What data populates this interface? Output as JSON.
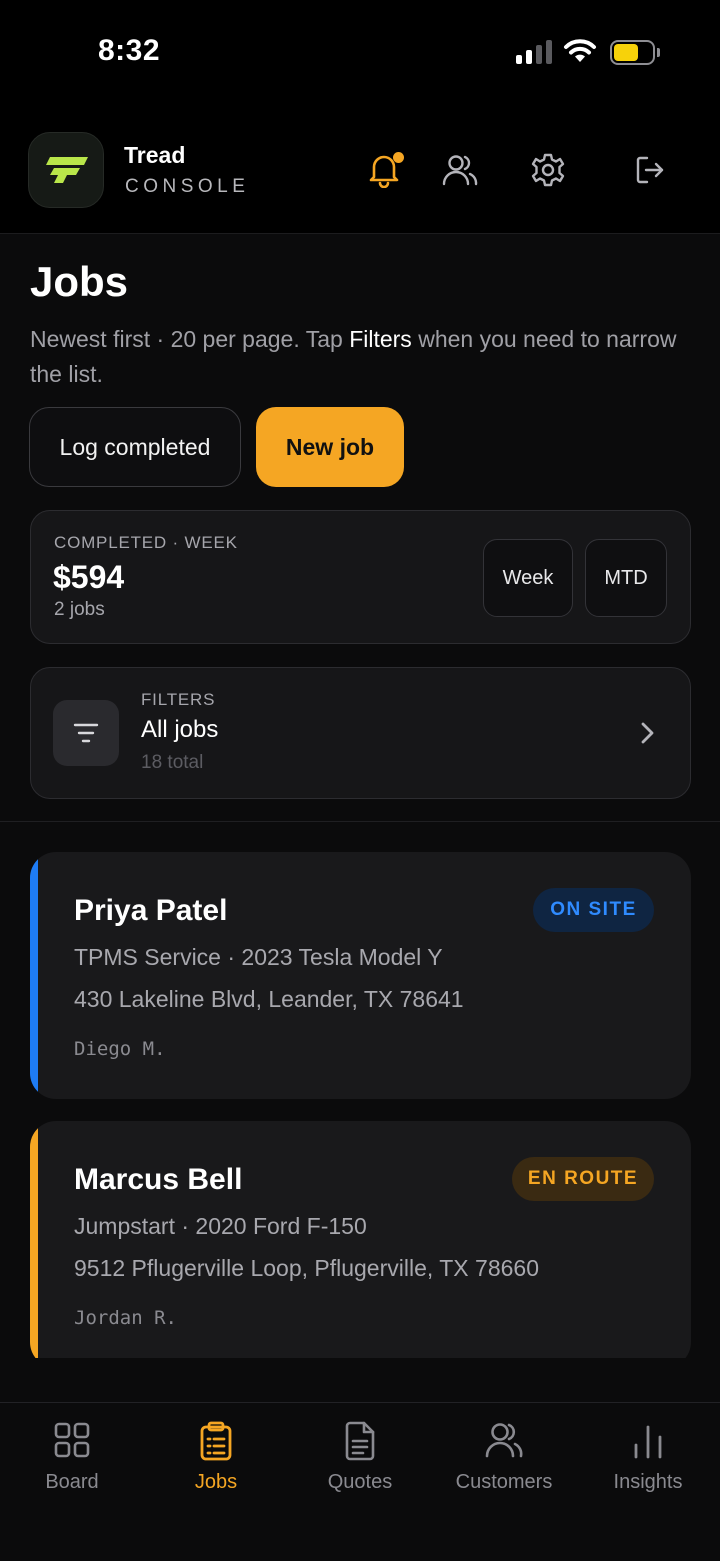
{
  "status_bar": {
    "time": "8:32"
  },
  "header": {
    "brand_name": "Tread",
    "brand_sub": "CONSOLE",
    "accent_color": "#f5a623",
    "icons": [
      "bell-icon",
      "team-icon",
      "gear-icon",
      "logout-icon"
    ]
  },
  "page": {
    "title": "Jobs",
    "subtitle_pre": "Newest first · 20 per page. Tap ",
    "subtitle_highlight": "Filters",
    "subtitle_post": " when you need to narrow the list."
  },
  "actions": {
    "log_completed": "Log completed",
    "new_job": "New job"
  },
  "stats": {
    "label": "COMPLETED · WEEK",
    "value": "$594",
    "count": "2 jobs",
    "periods": [
      "Week",
      "MTD"
    ]
  },
  "filters": {
    "label": "FILTERS",
    "value": "All jobs",
    "total": "18 total"
  },
  "jobs": [
    {
      "name": "Priya Patel",
      "service": "TPMS Service · 2023 Tesla Model Y",
      "address": "430 Lakeline Blvd, Leander, TX 78641",
      "tech": "Diego M.",
      "status": "ON SITE",
      "accent": "#1e7cf5"
    },
    {
      "name": "Marcus Bell",
      "service": "Jumpstart · 2020 Ford F-150",
      "address": "9512 Pflugerville Loop, Pflugerville, TX 78660",
      "tech": "Jordan R.",
      "status": "EN ROUTE",
      "accent": "#f5a623"
    }
  ],
  "tabs": [
    {
      "label": "Board",
      "icon": "board-icon",
      "active": false
    },
    {
      "label": "Jobs",
      "icon": "clipboard-icon",
      "active": true
    },
    {
      "label": "Quotes",
      "icon": "document-icon",
      "active": false
    },
    {
      "label": "Customers",
      "icon": "customers-icon",
      "active": false
    },
    {
      "label": "Insights",
      "icon": "bar-chart-icon",
      "active": false
    }
  ]
}
